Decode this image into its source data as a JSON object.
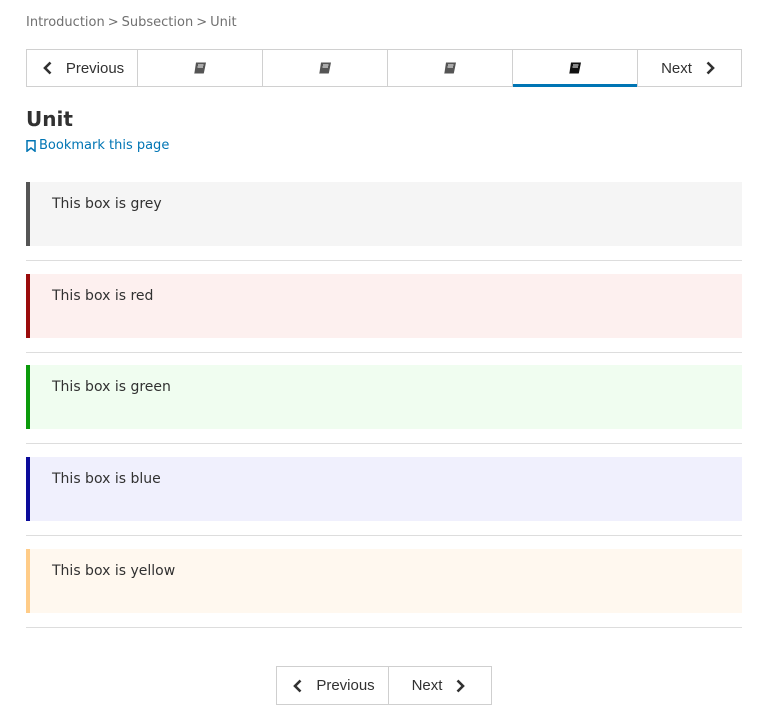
{
  "breadcrumb": {
    "items": [
      "Introduction",
      "Subsection",
      "Unit"
    ],
    "separator": ">"
  },
  "sequence_nav": {
    "previous_label": "Previous",
    "next_label": "Next",
    "units": [
      {
        "icon": "book-icon",
        "active": false
      },
      {
        "icon": "book-icon",
        "active": false
      },
      {
        "icon": "book-icon",
        "active": false
      },
      {
        "icon": "book-icon",
        "active": true
      }
    ]
  },
  "unit": {
    "title": "Unit",
    "bookmark_label": "Bookmark this page"
  },
  "boxes": [
    {
      "text": "This box is grey",
      "bg": "#f5f5f5",
      "border": "#555555"
    },
    {
      "text": "This box is red",
      "bg": "#fdf0ef",
      "border": "#9a0b0b"
    },
    {
      "text": "This box is green",
      "bg": "#f0fdf0",
      "border": "#0b9a0b"
    },
    {
      "text": "This box is blue",
      "bg": "#f0f0fd",
      "border": "#0b0b9a"
    },
    {
      "text": "This box is yellow",
      "bg": "#fff8ef",
      "border": "#ffcc88"
    }
  ],
  "bottom_nav": {
    "previous_label": "Previous",
    "next_label": "Next"
  },
  "colors": {
    "accent": "#0075b4"
  }
}
